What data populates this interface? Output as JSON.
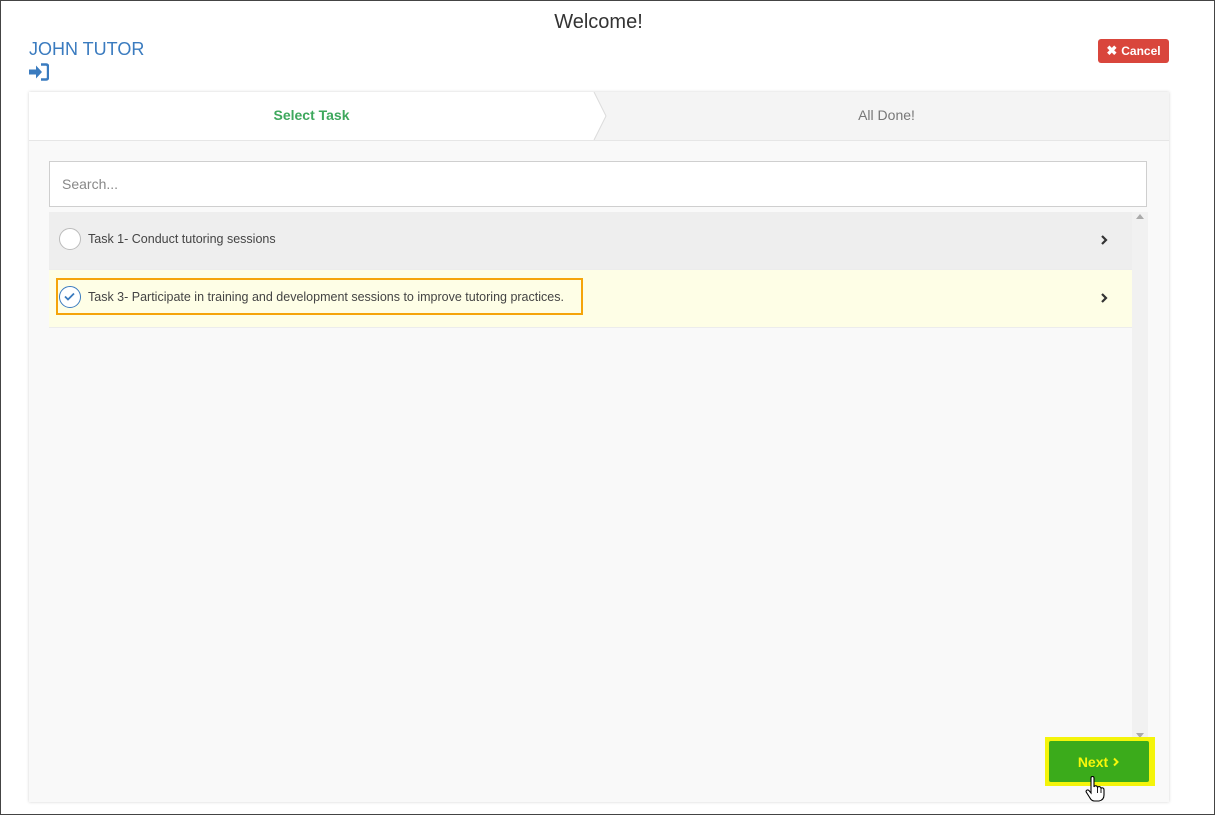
{
  "header": {
    "title": "Welcome!",
    "user_name": "JOHN TUTOR",
    "login_icon": "sign-in-icon",
    "cancel_label": "Cancel"
  },
  "wizard": {
    "steps": [
      {
        "label": "Select Task",
        "active": true
      },
      {
        "label": "All Done!",
        "active": false
      }
    ]
  },
  "search": {
    "placeholder": "Search...",
    "value": ""
  },
  "tasks": [
    {
      "label": "Task 1- Conduct tutoring sessions",
      "selected": false
    },
    {
      "label": "Task 3- Participate in training and development sessions to improve tutoring practices.",
      "selected": true
    }
  ],
  "footer": {
    "next_label": "Next"
  },
  "colors": {
    "accent_blue": "#3a7bbf",
    "active_step_green": "#3ea85d",
    "cancel_red": "#d9463c",
    "next_green": "#3bab1b",
    "highlight_yellow": "#f4f40a",
    "highlight_orange": "#f5a40a"
  }
}
